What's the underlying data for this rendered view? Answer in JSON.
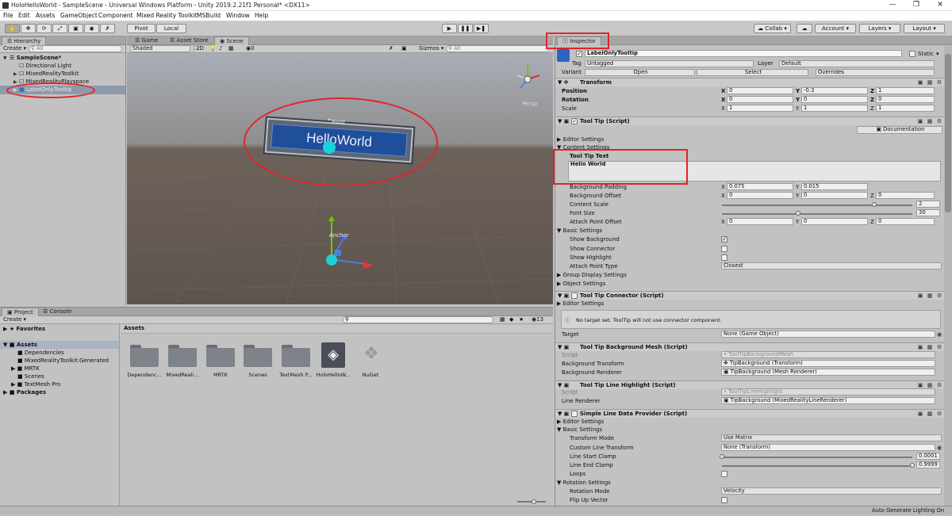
{
  "window": {
    "title": "HoloHelloWorld - SampleScene - Universal Windows Platform - Unity 2019.2.21f1 Personal* <DX11>"
  },
  "menu": [
    "File",
    "Edit",
    "Assets",
    "GameObject",
    "Component",
    "Mixed Reality Toolkit",
    "MSBuild",
    "Window",
    "Help"
  ],
  "toolbar": {
    "pivot": "Pivot",
    "local": "Local",
    "collab": "Collab",
    "account": "Account",
    "layers": "Layers",
    "layout": "Layout"
  },
  "hierarchy": {
    "tab": "Hierarchy",
    "create": "Create",
    "search_placeholder": "All",
    "scene": "SampleScene*",
    "items": [
      "Directional Light",
      "MixedRealityToolkit",
      "MixedRealityPlayspace",
      "LabelOnlyTooltip"
    ]
  },
  "scene_tabs": {
    "game": "Game",
    "asset_store": "Asset Store",
    "scene": "Scene"
  },
  "scene_toolbar": {
    "shading": "Shaded",
    "mode2d": "2D",
    "fx_count": "0",
    "gizmos": "Gizmos",
    "search_placeholder": "All"
  },
  "scene_view": {
    "tooltip_text": "HelloWorld",
    "pivot_label": "Pivot",
    "anchor_label": "Anchor",
    "persp": "Persp"
  },
  "project": {
    "tab_project": "Project",
    "tab_console": "Console",
    "create": "Create",
    "favorites": "Favorites",
    "tree": [
      "Assets",
      "Dependencies",
      "MixedRealityToolkit.Generated",
      "MRTK",
      "Scenes",
      "TextMesh Pro",
      "Packages"
    ],
    "breadcrumb": "Assets",
    "count": "13",
    "assets": [
      "Dependenc...",
      "MixedReali...",
      "MRTK",
      "Scenes",
      "TextMesh P...",
      "HoloHelloW...",
      "NuGet"
    ]
  },
  "inspector": {
    "tab": "Inspector",
    "object_name": "LabelOnlyTooltip",
    "static_label": "Static",
    "tag_label": "Tag",
    "tag_value": "Untagged",
    "layer_label": "Layer",
    "layer_value": "Default",
    "variant_label": "Variant",
    "open": "Open",
    "select": "Select",
    "overrides": "Overrides",
    "transform": {
      "title": "Transform",
      "position": {
        "label": "Position",
        "x": "0",
        "y": "-0.3",
        "z": "1"
      },
      "rotation": {
        "label": "Rotation",
        "x": "0",
        "y": "0",
        "z": "0"
      },
      "scale": {
        "label": "Scale",
        "x": "1",
        "y": "1",
        "z": "1"
      }
    },
    "tooltip": {
      "title": "Tool Tip (Script)",
      "documentation": "Documentation",
      "editor_settings": "Editor Settings",
      "content_settings": "Content Settings",
      "text_label": "Tool Tip Text",
      "text_value": "Hello World",
      "bg_padding": {
        "label": "Background Padding",
        "x": "0.075",
        "y": "0.015"
      },
      "bg_offset": {
        "label": "Background Offset",
        "x": "0",
        "y": "0",
        "z": "0"
      },
      "content_scale": {
        "label": "Content Scale",
        "value": "2",
        "fraction": 0.8
      },
      "font_size": {
        "label": "Font Size",
        "value": "30",
        "fraction": 0.4
      },
      "attach_offset": {
        "label": "Attach Point Offset",
        "x": "0",
        "y": "0",
        "z": "0"
      },
      "basic_settings": "Basic Settings",
      "show_background": "Show Background",
      "show_connector": "Show Connector",
      "show_highlight": "Show Highlight",
      "attach_type_label": "Attach Point Type",
      "attach_type_value": "Closest",
      "group_display": "Group Display Settings",
      "object_settings": "Object Settings"
    },
    "connector": {
      "title": "Tool Tip Connector (Script)",
      "editor_settings": "Editor Settings",
      "warning": "No target set. ToolTip will not use connector component.",
      "target_label": "Target",
      "target_value": "None (Game Object)"
    },
    "bg_mesh": {
      "title": "Tool Tip Background Mesh (Script)",
      "script_label": "Script",
      "script_value": "ToolTipBackgroundMesh",
      "bt_label": "Background Transform",
      "bt_value": "TipBackground (Transform)",
      "br_label": "Background Renderer",
      "br_value": "TipBackground (Mesh Renderer)"
    },
    "line_highlight": {
      "title": "Tool Tip Line Highlight (Script)",
      "script_label": "Script",
      "script_value": "ToolTipLineHighlight",
      "lr_label": "Line Renderer",
      "lr_value": "TipBackground (MixedRealityLineRenderer)"
    },
    "line_provider": {
      "title": "Simple Line Data Provider (Script)",
      "editor_settings": "Editor Settings",
      "basic_settings": "Basic Settings",
      "tm_label": "Transform Mode",
      "tm_value": "Use Matrix",
      "clt_label": "Custom Line Transform",
      "clt_value": "None (Transform)",
      "lsc_label": "Line Start Clamp",
      "lsc_value": "0.0001",
      "lsc_fraction": 0.0,
      "lec_label": "Line End Clamp",
      "lec_value": "0.9999",
      "lec_fraction": 1.0,
      "loops": "Loops",
      "rotation_settings": "Rotation Settings",
      "rm_label": "Rotation Mode",
      "rm_value": "Velocity",
      "fuv": "Flip Up Vector"
    }
  },
  "status": "Auto Generate Lighting On"
}
